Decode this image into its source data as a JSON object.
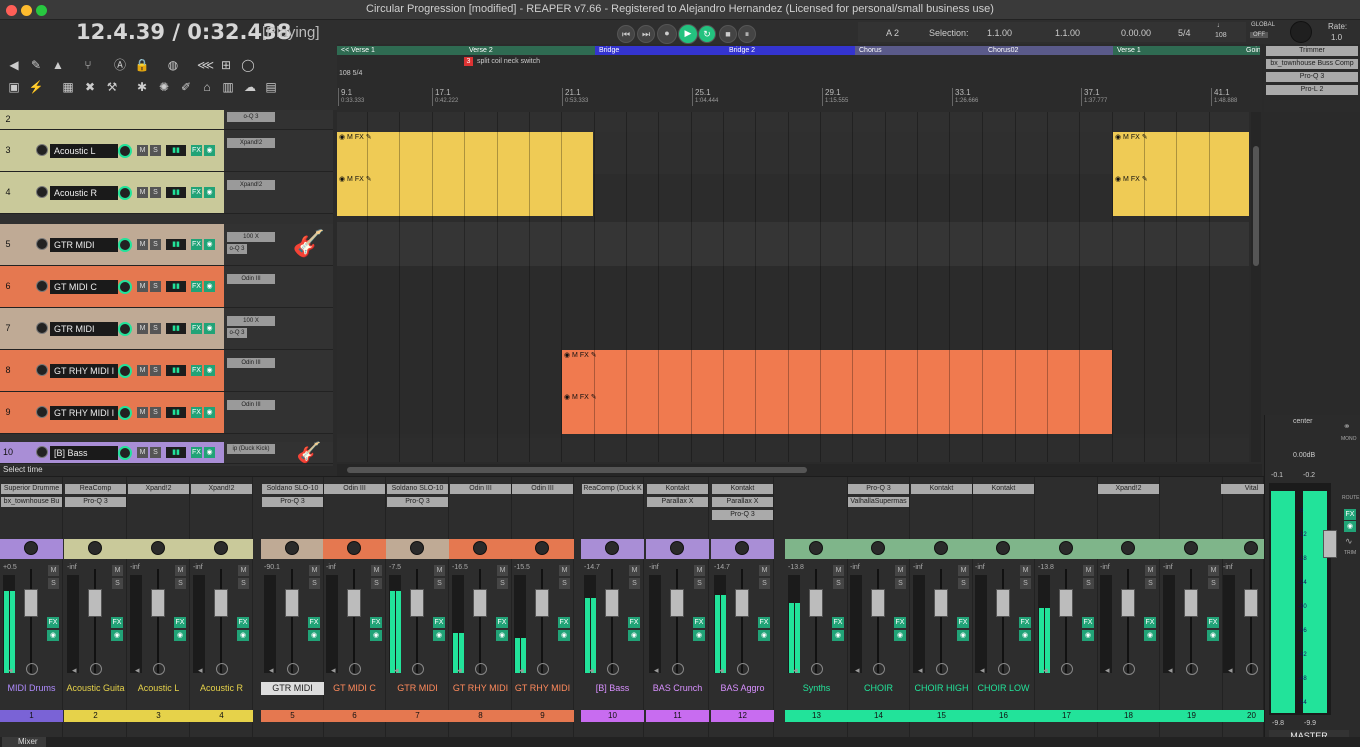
{
  "window": {
    "title": "Circular Progression [modified] - REAPER v7.66 - Registered to Alejandro Hernandez (Licensed for personal/small business use)"
  },
  "transport": {
    "time": "12.4.39 / 0:32.438",
    "state": "[Playing]",
    "button_rewind": "⏮",
    "button_forward": "⏭",
    "button_record": "●",
    "button_play": "▶",
    "button_loop": "↻",
    "button_stop": "■",
    "button_pause": "⏸"
  },
  "info": {
    "marker_label": "A 2",
    "selection_label": "Selection:",
    "sel_start": "1.1.00",
    "sel_end": "1.1.00",
    "sel_len": "0.00.00",
    "timesig": "5/4",
    "bpm_top": "♩",
    "bpm": "108",
    "global": "GLOBAL",
    "global_off": "OFF",
    "rate_label": "Rate:",
    "rate_value": "1.0"
  },
  "regions": [
    {
      "label": "<<  Verse 1",
      "color": "#2f6b52"
    },
    {
      "label": "Verse 2",
      "color": "#2f6b52"
    },
    {
      "label": "Bridge",
      "color": "#3434d0"
    },
    {
      "label": "Bridge 2",
      "color": "#3434d0"
    },
    {
      "label": "Chorus",
      "color": "#5a5a8a"
    },
    {
      "label": "Chorus02",
      "color": "#5a5a8a"
    },
    {
      "label": "Verse 1",
      "color": "#2f6b52"
    },
    {
      "label": "Going",
      "color": "#2f6b52"
    }
  ],
  "marker": {
    "num": "3",
    "text": "split coil neck switch"
  },
  "tempo_marker": "108 5/4",
  "bars": [
    {
      "bar": "9.1",
      "time": "0:33.333"
    },
    {
      "bar": "17.1",
      "time": "0:42.222"
    },
    {
      "bar": "21.1",
      "time": "0:53.333"
    },
    {
      "bar": "25.1",
      "time": "1:04.444"
    },
    {
      "bar": "29.1",
      "time": "1:15.555"
    },
    {
      "bar": "33.1",
      "time": "1:26.666"
    },
    {
      "bar": "37.1",
      "time": "1:37.777"
    },
    {
      "bar": "41.1",
      "time": "1:48.888"
    }
  ],
  "master_fx": [
    "Trimmer",
    "bx_townhouse Buss Comp",
    "Pro-Q 3",
    "Pro-L 2"
  ],
  "tracks": [
    {
      "num": "2",
      "name": "",
      "color": "#c9c99a",
      "insert": "o-Q 3",
      "insert2": ""
    },
    {
      "num": "3",
      "name": "Acoustic L",
      "color": "#c9c99a",
      "insert": "Xpand!2",
      "insert2": ""
    },
    {
      "num": "4",
      "name": "Acoustic R",
      "color": "#c9c99a",
      "insert": "Xpand!2",
      "insert2": ""
    },
    {
      "num": "5",
      "name": "GTR MIDI",
      "color": "#bfaa95",
      "insert": "100 X",
      "insert2": "o-Q 3"
    },
    {
      "num": "6",
      "name": "GT MIDI C",
      "color": "#e57850",
      "insert": "Odin III",
      "insert2": ""
    },
    {
      "num": "7",
      "name": "GTR MIDI",
      "color": "#bfaa95",
      "insert": "100 X",
      "insert2": "o-Q 3"
    },
    {
      "num": "8",
      "name": "GT RHY MIDI I",
      "color": "#e57850",
      "insert": "Odin III",
      "insert2": ""
    },
    {
      "num": "9",
      "name": "GT RHY MIDI I",
      "color": "#e57850",
      "insert": "Odin III",
      "insert2": ""
    },
    {
      "num": "10",
      "name": "[B] Bass",
      "color": "#a98ed6",
      "insert": "ip (Duck Kick)",
      "insert2": ""
    }
  ],
  "selecttime": "Select time",
  "strips": [
    {
      "name": "MIDI Drums",
      "num": "1",
      "color": "#7a63d6",
      "namecolor": "#b08cff",
      "fx": [
        "Superior Drumme",
        "bx_townhouse Bu"
      ],
      "db": "+0.5",
      "pan": "#a78ad8"
    },
    {
      "name": "Acoustic Guita",
      "num": "2",
      "color": "#e6d24a",
      "namecolor": "#e6d24a",
      "fx": [
        "ReaComp",
        "Pro-Q 3"
      ],
      "db": "-inf",
      "pan": "#c9c99a"
    },
    {
      "name": "Acoustic L",
      "num": "3",
      "color": "#e6d24a",
      "namecolor": "#e6d24a",
      "fx": [
        "Xpand!2"
      ],
      "db": "-inf",
      "pan": "#c9c99a"
    },
    {
      "name": "Acoustic R",
      "num": "4",
      "color": "#e6d24a",
      "namecolor": "#e6d24a",
      "fx": [
        "Xpand!2"
      ],
      "db": "-inf",
      "pan": "#c9c99a"
    },
    {
      "name": "GTR MIDI",
      "num": "5",
      "color": "#e57850",
      "namecolor": "#222",
      "fx": [
        "Soldano SLO-10",
        "Pro-Q 3"
      ],
      "db": "-90.1",
      "pan": "#bfaa95"
    },
    {
      "name": "GT MIDI C",
      "num": "6",
      "color": "#e57850",
      "namecolor": "#ff8a5c",
      "fx": [
        "Odin III"
      ],
      "db": "-inf",
      "pan": "#e57850"
    },
    {
      "name": "GTR MIDI",
      "num": "7",
      "color": "#e57850",
      "namecolor": "#ff8a5c",
      "fx": [
        "Soldano SLO-10",
        "Pro-Q 3"
      ],
      "db": "-7.5",
      "pan": "#bfaa95"
    },
    {
      "name": "GT RHY MIDI",
      "num": "8",
      "color": "#e57850",
      "namecolor": "#ff8a5c",
      "fx": [
        "Odin III"
      ],
      "db": "-16.5",
      "pan": "#e57850"
    },
    {
      "name": "GT RHY MIDI",
      "num": "9",
      "color": "#e57850",
      "namecolor": "#ff8a5c",
      "fx": [
        "Odin III"
      ],
      "db": "-15.5",
      "pan": "#e57850"
    },
    {
      "name": "[B] Bass",
      "num": "10",
      "color": "#c86cf0",
      "namecolor": "#d890ff",
      "fx": [
        "ReaComp (Duck K"
      ],
      "db": "-14.7",
      "pan": "#a98ed6"
    },
    {
      "name": "BAS Crunch",
      "num": "11",
      "color": "#c86cf0",
      "namecolor": "#d890ff",
      "fx": [
        "Kontakt",
        "Parallax X"
      ],
      "db": "-inf",
      "pan": "#a98ed6"
    },
    {
      "name": "BAS Aggro",
      "num": "12",
      "color": "#c86cf0",
      "namecolor": "#d890ff",
      "fx": [
        "Kontakt",
        "Parallax X",
        "Pro-Q 3"
      ],
      "db": "-14.7",
      "pan": "#a98ed6"
    },
    {
      "name": "Synths",
      "num": "13",
      "color": "#22e39a",
      "namecolor": "#22e39a",
      "fx": [],
      "db": "-13.8",
      "pan": "#7fb58a"
    },
    {
      "name": "CHOIR",
      "num": "14",
      "color": "#22e39a",
      "namecolor": "#22e39a",
      "fx": [
        "Pro-Q 3",
        "ValhallaSupermas"
      ],
      "db": "-inf",
      "pan": "#7fb58a"
    },
    {
      "name": "CHOIR HIGH",
      "num": "15",
      "color": "#22e39a",
      "namecolor": "#22e39a",
      "fx": [
        "Kontakt"
      ],
      "db": "-inf",
      "pan": "#7fb58a"
    },
    {
      "name": "CHOIR LOW",
      "num": "16",
      "color": "#22e39a",
      "namecolor": "#22e39a",
      "fx": [
        "Kontakt"
      ],
      "db": "-inf",
      "pan": "#7fb58a"
    },
    {
      "name": "",
      "num": "17",
      "color": "#22e39a",
      "namecolor": "#22e39a",
      "fx": [],
      "db": "-13.8",
      "pan": "#7fb58a"
    },
    {
      "name": "",
      "num": "18",
      "color": "#22e39a",
      "namecolor": "#22e39a",
      "fx": [
        "Xpand!2"
      ],
      "db": "-inf",
      "pan": "#7fb58a"
    },
    {
      "name": "",
      "num": "19",
      "color": "#22e39a",
      "namecolor": "#22e39a",
      "fx": [],
      "db": "-inf",
      "pan": "#7fb58a"
    },
    {
      "name": "",
      "num": "20",
      "color": "#22e39a",
      "namecolor": "#22e39a",
      "fx": [
        "Vital"
      ],
      "db": "-inf",
      "pan": "#7fb58a"
    }
  ],
  "master": {
    "pan_label": "center",
    "db_label": "0.00dB",
    "left_db": "-0.1",
    "right_db": "-0.2",
    "peak_l": "-9.8",
    "peak_r": "-9.9",
    "name": "MASTER",
    "mono": "MONO",
    "route": "ROUTE",
    "trim": "TRIM",
    "fx": "FX",
    "scale": [
      "-6",
      "-12",
      "-18",
      "-24",
      "-30",
      "-36",
      "-42",
      "-48",
      "-54"
    ]
  },
  "mixer_tab": "Mixer",
  "colors": {
    "accent": "#22e39a",
    "fx_green": "#21a377",
    "playing": "#23c27f"
  }
}
